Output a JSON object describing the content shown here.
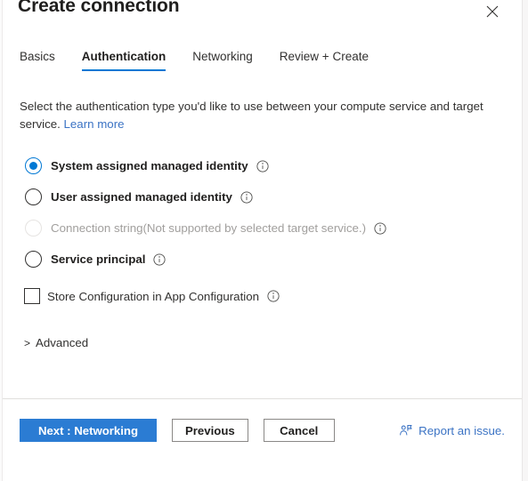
{
  "dialog": {
    "title": "Create connection",
    "close_icon": "close-icon"
  },
  "tabs": [
    {
      "label": "Basics",
      "active": false
    },
    {
      "label": "Authentication",
      "active": true
    },
    {
      "label": "Networking",
      "active": false
    },
    {
      "label": "Review + Create",
      "active": false
    }
  ],
  "description": {
    "text": "Select the authentication type you'd like to use between your compute service and target service.",
    "link_label": "Learn more"
  },
  "auth_options": [
    {
      "label": "System assigned managed identity",
      "checked": true,
      "disabled": false,
      "info_icon": "info-icon"
    },
    {
      "label": "User assigned managed identity",
      "checked": false,
      "disabled": false,
      "info_icon": "info-icon"
    },
    {
      "label": "Connection string(Not supported by selected target service.)",
      "checked": false,
      "disabled": true,
      "info_icon": "info-icon"
    },
    {
      "label": "Service principal",
      "checked": false,
      "disabled": false,
      "info_icon": "info-icon"
    }
  ],
  "store_config": {
    "label": "Store Configuration in App Configuration",
    "checked": false,
    "info_icon": "info-icon"
  },
  "advanced": {
    "label": "Advanced",
    "expanded": false,
    "chevron_icon": "chevron-right-icon"
  },
  "footer": {
    "next_label": "Next : Networking",
    "previous_label": "Previous",
    "cancel_label": "Cancel",
    "report_label": "Report an issue.",
    "report_icon": "feedback-person-icon"
  },
  "colors": {
    "accent": "#0078d4",
    "primary_button": "#2b7cd3",
    "link": "#3b73c4",
    "text": "#323130",
    "disabled_text": "#a19f9d"
  }
}
